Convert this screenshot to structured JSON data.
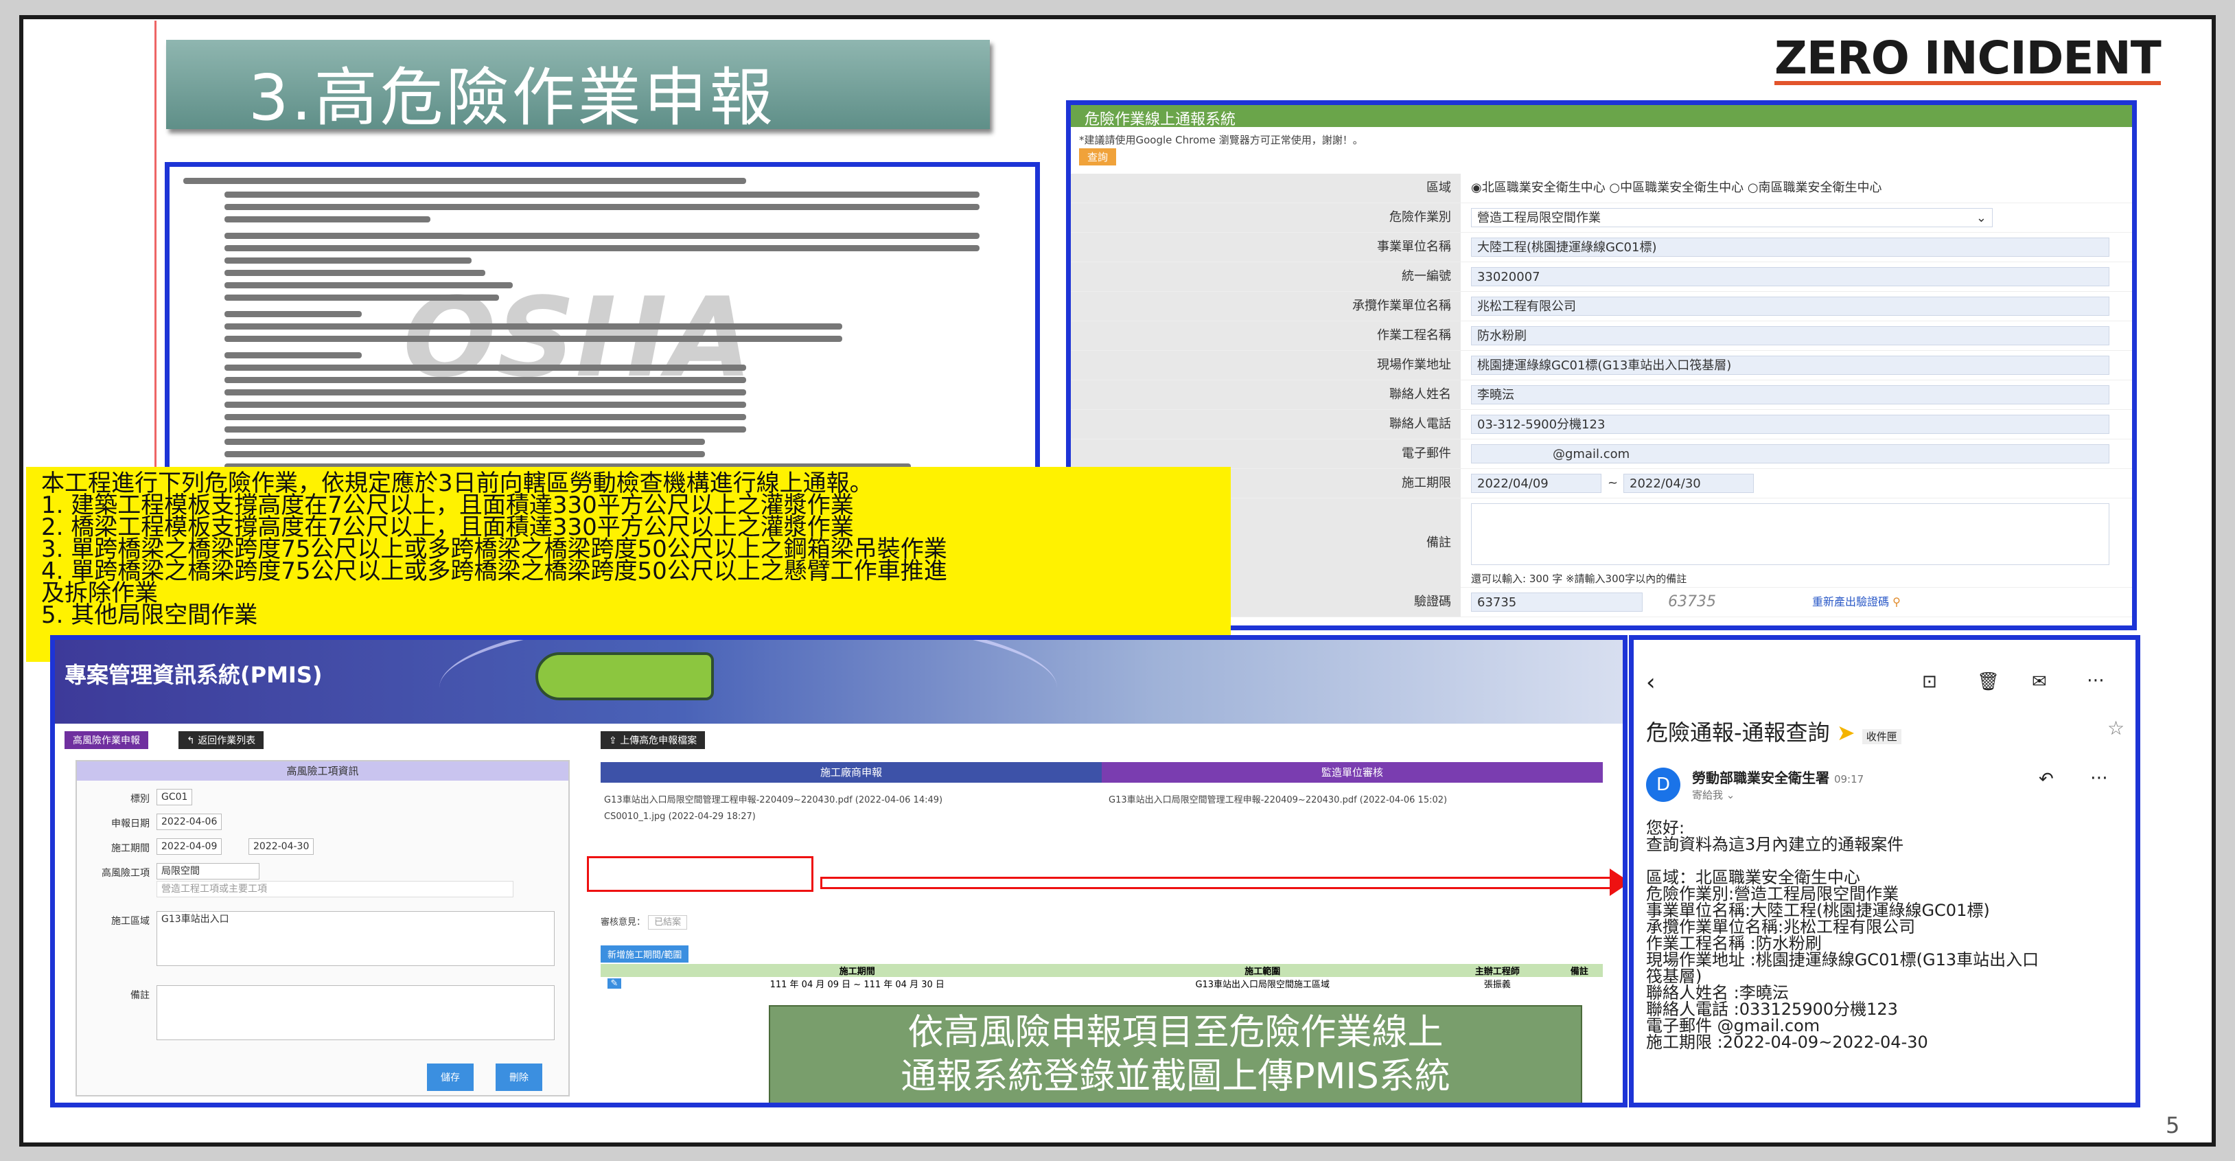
{
  "slide": {
    "title": "3.高危險作業申報",
    "logo": "ZERO INCIDENT",
    "page_number": "5"
  },
  "scan": {
    "watermark": "OSHA"
  },
  "note": {
    "lines": [
      "本工程進行下列危險作業，依規定應於3日前向轄區勞動檢查機構進行線上通報。",
      "1. 建築工程模板支撐高度在7公尺以上，且面積達330平方公尺以上之灌漿作業",
      "2. 橋梁工程模板支撐高度在7公尺以上，且面積達330平方公尺以上之灌漿作業",
      "3. 單跨橋梁之橋梁跨度75公尺以上或多跨橋梁之橋梁跨度50公尺以上之鋼箱梁吊裝作業",
      "4. 單跨橋梁之橋梁跨度75公尺以上或多跨橋梁之橋梁跨度50公尺以上之懸臂工作車推進",
      "及拆除作業",
      "5. 其他局限空間作業"
    ]
  },
  "form": {
    "header": "危險作業線上通報系統",
    "warning": "*建議請使用Google Chrome 瀏覽器方可正常使用，謝謝！。",
    "query_button": "查詢",
    "rows": [
      {
        "label": "區域",
        "value": "◉北區職業安全衛生中心 ○中區職業安全衛生中心 ○南區職業安全衛生中心",
        "plain": true
      },
      {
        "label": "危險作業別",
        "value": "營造工程局限空間作業"
      },
      {
        "label": "事業單位名稱",
        "value": "大陸工程(桃園捷運綠線GC01標)"
      },
      {
        "label": "統一編號",
        "value": "33020007"
      },
      {
        "label": "承攬作業單位名稱",
        "value": "兆松工程有限公司"
      },
      {
        "label": "作業工程名稱",
        "value": "防水粉刷"
      },
      {
        "label": "現場作業地址",
        "value": "桃園捷運綠線GC01標(G13車站出入口筏基層)"
      },
      {
        "label": "聯絡人姓名",
        "value": "李曉沄"
      },
      {
        "label": "聯絡人電話",
        "value": "03-312-5900分機123"
      },
      {
        "label": "電子郵件",
        "value": "@gmail.com"
      }
    ],
    "period_label": "施工期限",
    "period_from": "2022/04/09",
    "period_to": "2022/04/30",
    "remarks_label": "備註",
    "remarks_hint": "還可以輸入: 300 字  ※請輸入300字以內的備註",
    "captcha_label": "驗證碼",
    "captcha_value": "63735",
    "captcha_image": "63735",
    "captcha_refresh": "重新產出驗證碼"
  },
  "pmis": {
    "banner_title": "專案管理資訊系統(PMIS)",
    "btn_hazard": "高風險作業申報",
    "btn_back": "返回作業列表",
    "btn_upload": "上傳高危申報檔案",
    "left_panel_title": "高風險工項資訊",
    "fields": [
      {
        "label": "標別",
        "value": "GC01"
      },
      {
        "label": "申報日期",
        "value": "2022-04-06"
      },
      {
        "label": "施工期間",
        "value": "2022-04-09"
      },
      {
        "label": "高風險工項",
        "value": "局限空間"
      },
      {
        "label": "施工區域",
        "value": "G13車站出入口"
      },
      {
        "label": "備註",
        "value": ""
      }
    ],
    "period_to": "2022-04-30",
    "hint": "營造工程工項或主要工項",
    "btn_save": "儲存",
    "btn_delete": "刪除",
    "col_contractor": "施工廠商申報",
    "col_supervisor": "監造單位審核",
    "doc1": "G13車站出入口局限空間管理工程申報-220409~220430.pdf  (2022-04-06 14:49)",
    "doc2": "CS0010_1.jpg  (2022-04-29 18:27)",
    "doc3": "G13車站出入口局限空間管理工程申報-220409~220430.pdf  (2022-04-06 15:02)",
    "review_label": "審核意見：",
    "review_value": "已結案",
    "add_btn": "新增施工期間/範圍",
    "table_headers": [
      "",
      "施工期間",
      "施工範圍",
      "主辦工程師",
      "備註"
    ],
    "table_row": [
      "",
      "111 年 04 月 09 日 ~ 111 年 04 月 30 日",
      "G13車站出入口局限空間施工區域",
      "張振義",
      ""
    ],
    "caption_line1": "依高風險申報項目至危險作業線上",
    "caption_line2": "通報系統登錄並截圖上傳PMIS系統"
  },
  "mail": {
    "subject": "危險通報-通報查詢",
    "folder": "收件匣",
    "sender_initial": "D",
    "sender": "勞動部職業安全衛生署",
    "time": "09:17",
    "to": "寄給我 ⌄",
    "body": [
      "您好:",
      "查詢資料為這3月內建立的通報案件",
      "",
      "區域：北區職業安全衛生中心",
      "危險作業別:營造工程局限空間作業",
      "事業單位名稱:大陸工程(桃園捷運綠線GC01標)",
      "承攬作業單位名稱:兆松工程有限公司",
      "作業工程名稱 :防水粉刷",
      "現場作業地址 :桃園捷運綠線GC01標(G13車站出入口",
      "筏基層)",
      "聯絡人姓名 :李曉沄",
      "聯絡人電話 :033125900分機123",
      "電子郵件               @gmail.com",
      "施工期限 :2022-04-09~2022-04-30"
    ]
  }
}
